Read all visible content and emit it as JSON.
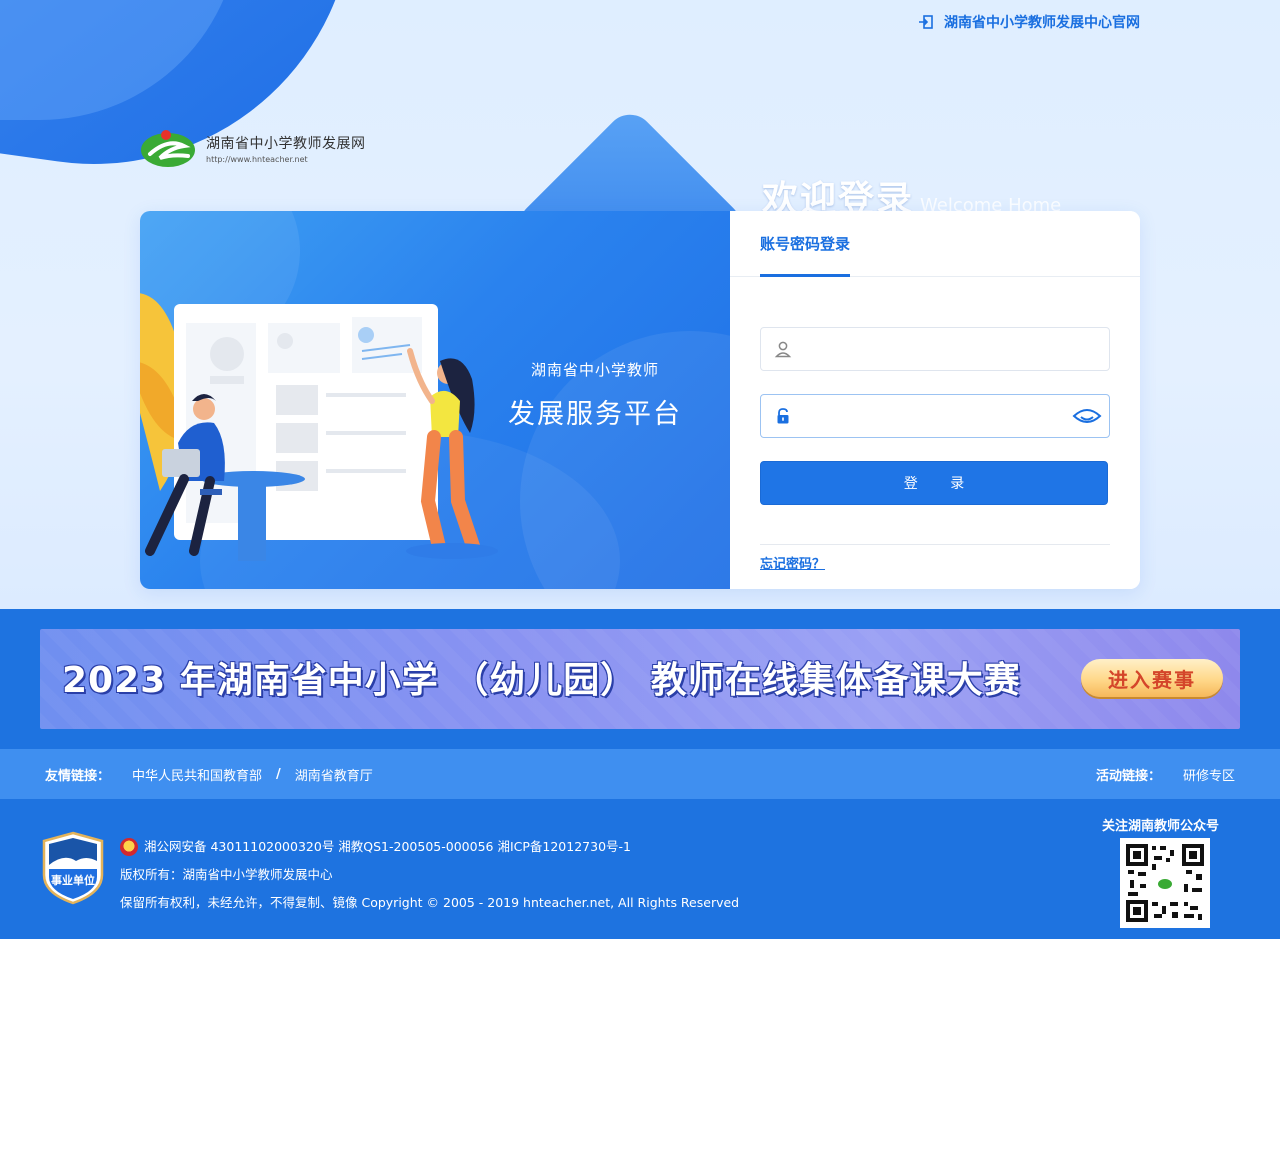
{
  "top_link": {
    "label": "湖南省中小学教师发展中心官网"
  },
  "brand": {
    "name": "湖南省中小学教师发展网",
    "url": "http://www.hnteacher.net"
  },
  "welcome": {
    "cn": "欢迎登录",
    "en": "Welcome Home"
  },
  "slogan": {
    "line1": "湖南省中小学教师",
    "line2": "发展服务平台"
  },
  "login": {
    "tab": "账号密码登录",
    "username_value": "",
    "password_value": "",
    "submit_label": "登 录",
    "forgot_label": "忘记密码？"
  },
  "banner": {
    "text": "2023 年湖南省中小学 （幼儿园） 教师在线集体备课大赛",
    "button": "进入赛事"
  },
  "links": {
    "friend_label": "友情链接：",
    "friend_items": [
      "中华人民共和国教育部",
      "湖南省教育厅"
    ],
    "separator": "/",
    "activity_label": "活动链接：",
    "activity_items": [
      "研修专区"
    ]
  },
  "footer": {
    "badge_text": "事业单位",
    "line1": "湘公网安备 43011102000320号  湘教QS1-200505-000056  湘ICP备12012730号-1",
    "line2": "版权所有：湖南省中小学教师发展中心",
    "line3": "保留所有权利，未经允许，不得复制、镜像 Copyright © 2005 - 2019 hnteacher.net, All Rights Reserved",
    "qr_title": "关注湖南教师公众号"
  },
  "colors": {
    "primary": "#1e73e0",
    "link_bar": "#3f8ff0",
    "accent_text": "#1a6fe0"
  },
  "icons": {
    "top_link": "login-arrow-icon",
    "user": "user-icon",
    "lock": "lock-icon",
    "eye": "eye-icon"
  }
}
